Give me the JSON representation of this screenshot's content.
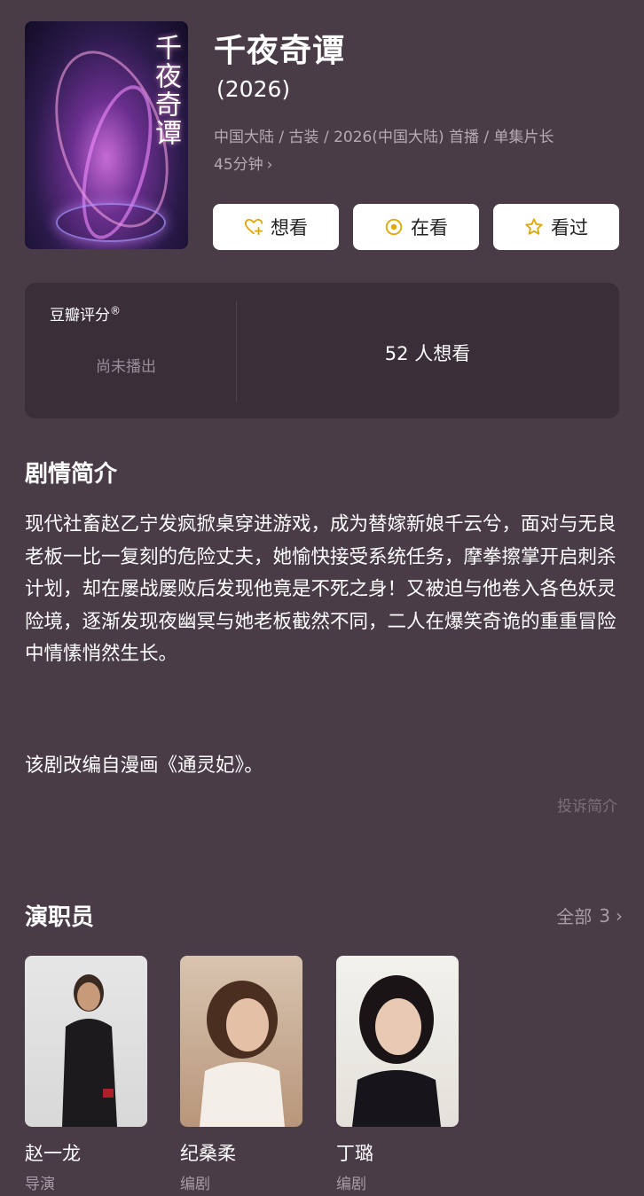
{
  "poster": {
    "title_art": "千夜奇谭"
  },
  "show": {
    "title": "千夜奇谭",
    "year": "(2026)",
    "meta_line1": "中国大陆 / 古装 / 2026(中国大陆) 首播 / 单集片长",
    "meta_line2": "45分钟",
    "meta_chevron": "›"
  },
  "actions": {
    "want": "想看",
    "watching": "在看",
    "watched": "看过"
  },
  "rating": {
    "label": "豆瓣评分",
    "registered": "®",
    "status": "尚未播出",
    "want_count": "52 人想看"
  },
  "synopsis": {
    "heading": "剧情简介",
    "text": "现代社畜赵乙宁发疯掀桌穿进游戏，成为替嫁新娘千云兮，面对与无良老板一比一复刻的危险丈夫，她愉快接受系统任务，摩拳擦掌开启刺杀计划，却在屡战屡败后发现他竟是不死之身！又被迫与他卷入各色妖灵险境，逐渐发现夜幽冥与她老板截然不同，二人在爆笑奇诡的重重冒险中情愫悄然生长。",
    "adapted": "该剧改编自漫画《通灵妃》。",
    "report": "投诉简介"
  },
  "cast": {
    "heading": "演职员",
    "all_label": "全部",
    "count": "3",
    "chevron": "›",
    "members": [
      {
        "name": "赵一龙",
        "role": "导演"
      },
      {
        "name": "纪桑柔",
        "role": "编剧"
      },
      {
        "name": "丁璐",
        "role": "编剧"
      }
    ]
  },
  "colors": {
    "background": "#4a3c47",
    "card": "#3a2e39",
    "button": "#ffffff",
    "accent_icon": "#e0a800",
    "muted_text": "#b6a9b2"
  },
  "icons": {
    "want": "heart-plus-icon",
    "watching": "target-circle-icon",
    "watched": "star-icon"
  }
}
